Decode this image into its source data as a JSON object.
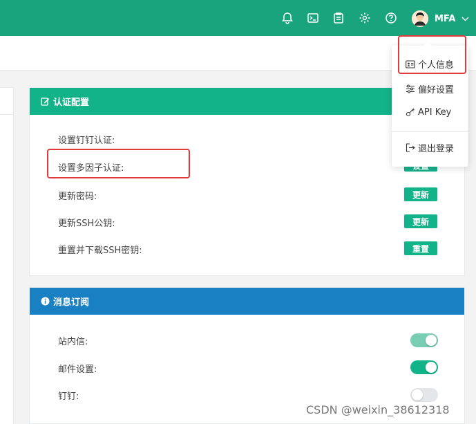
{
  "header": {
    "user_name": "MFA",
    "icons": [
      "bell-icon",
      "terminal-icon",
      "clipboard-icon",
      "gear-icon",
      "help-icon"
    ]
  },
  "user_menu": {
    "items": [
      {
        "label": "个人信息",
        "icon": "id-card-icon"
      },
      {
        "label": "偏好设置",
        "icon": "sliders-icon"
      },
      {
        "label": "API Key",
        "icon": "key-icon"
      },
      {
        "label": "退出登录",
        "icon": "logout-icon"
      }
    ]
  },
  "auth_config": {
    "title": "认证配置",
    "rows": [
      {
        "label": "设置钉钉认证:",
        "button": ""
      },
      {
        "label": "设置多因子认证:",
        "button": "设置"
      },
      {
        "label": "更新密码:",
        "button": "更新"
      },
      {
        "label": "更新SSH公钥:",
        "button": "更新"
      },
      {
        "label": "重置并下载SSH密钥:",
        "button": "重置"
      }
    ]
  },
  "subscription": {
    "title": "消息订阅",
    "rows": [
      {
        "label": "站内信:",
        "enabled": true,
        "disabled_style": true
      },
      {
        "label": "邮件设置:",
        "enabled": true,
        "disabled_style": false
      },
      {
        "label": "钉钉:",
        "enabled": false,
        "disabled_style": false
      }
    ]
  },
  "colors": {
    "topbar": "#1aa47d",
    "auth_header": "#13b38a",
    "subscription_header": "#1a80c4",
    "highlight": "#e23a3a"
  },
  "watermark": "CSDN @weixin_38612318"
}
